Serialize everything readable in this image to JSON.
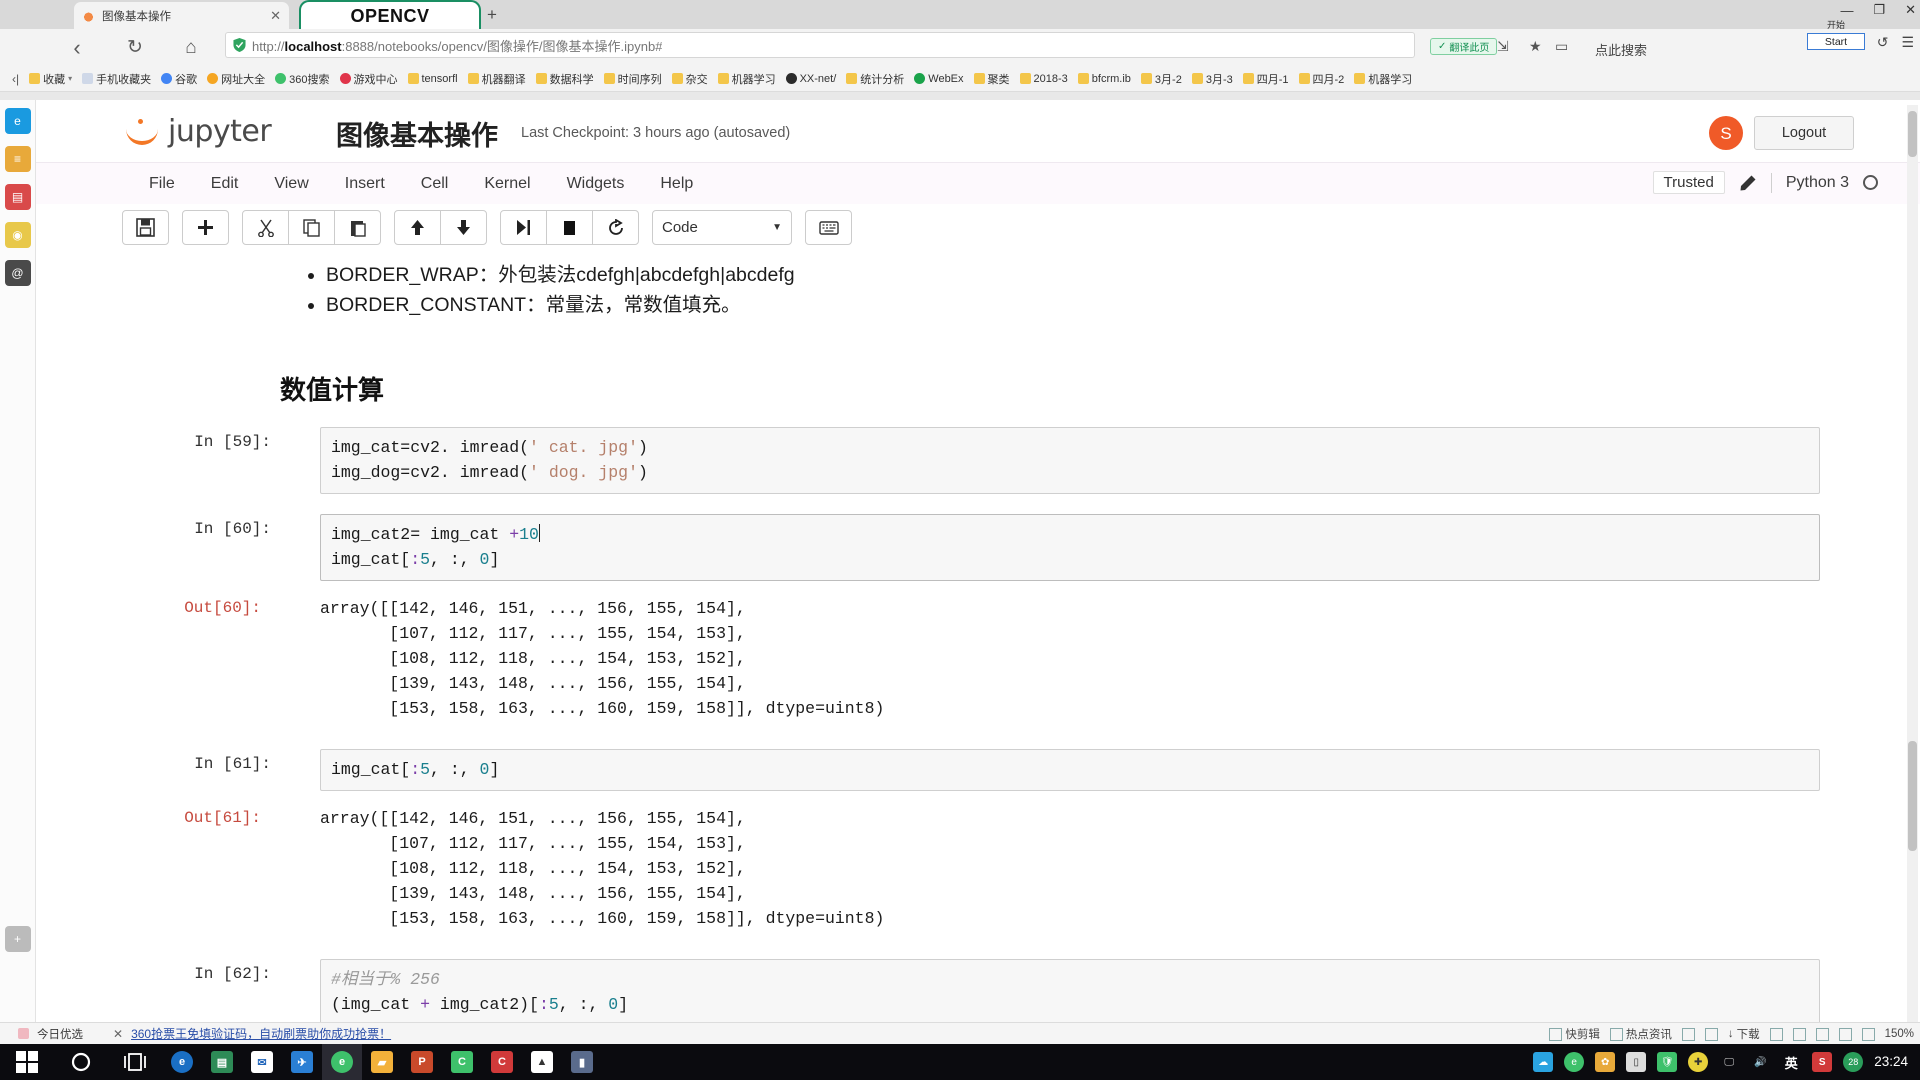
{
  "browser": {
    "tab": {
      "title": "图像基本操作",
      "close": "✕",
      "favicon_icon": "jupyter-favicon"
    },
    "tab_overlay": {
      "title": "OPENCV"
    },
    "new_tab": "+",
    "window_controls": {
      "minimize": "—",
      "maximize": "❐",
      "close": "✕"
    },
    "nav": {
      "back": "‹",
      "reload": "↻",
      "home": "⌂"
    },
    "url": {
      "scheme": "http://",
      "host": "localhost",
      "rest": ":8888/notebooks/opencv/图像操作/图像基本操作.ipynb#"
    },
    "translate_chip": "翻译此页",
    "search_hint": "点此搜索",
    "right_icons": {
      "share": "share-icon",
      "star": "star-icon",
      "collections": "collections-icon",
      "history": "history-icon",
      "menu": "menu-icon"
    },
    "bookmarks": [
      {
        "label": "收藏",
        "color": "#f3c64a"
      },
      {
        "label": "手机收藏夹",
        "color": "#cfd8e8"
      },
      {
        "label": "谷歌",
        "color": "#4285f4"
      },
      {
        "label": "网址大全",
        "color": "#f5a623"
      },
      {
        "label": "360搜索",
        "color": "#3ec16b"
      },
      {
        "label": "游戏中心",
        "color": "#e0344a"
      },
      {
        "label": "tensorfl",
        "color": "#f3c64a"
      },
      {
        "label": "机器翻译",
        "color": "#f3c64a"
      },
      {
        "label": "数据科学",
        "color": "#f3c64a"
      },
      {
        "label": "时间序列",
        "color": "#f3c64a"
      },
      {
        "label": "杂交",
        "color": "#f3c64a"
      },
      {
        "label": "机器学习",
        "color": "#f3c64a"
      },
      {
        "label": "XX-net/",
        "color": "#2b2b2b"
      },
      {
        "label": "统计分析",
        "color": "#f3c64a"
      },
      {
        "label": "WebEx",
        "color": "#1aa34a"
      },
      {
        "label": "聚类",
        "color": "#f3c64a"
      },
      {
        "label": "2018-3",
        "color": "#f3c64a"
      },
      {
        "label": "bfcrm.ib",
        "color": "#f3c64a"
      },
      {
        "label": "3月-2",
        "color": "#f3c64a"
      },
      {
        "label": "3月-3",
        "color": "#f3c64a"
      },
      {
        "label": "四月-1",
        "color": "#f3c64a"
      },
      {
        "label": "四月-2",
        "color": "#f3c64a"
      },
      {
        "label": "机器学习",
        "color": "#f3c64a"
      }
    ]
  },
  "start_popup": {
    "caption": "开始",
    "button": "Start"
  },
  "left_strip": [
    {
      "name": "edge-icon",
      "color": "#1a9ae0",
      "glyph": "e"
    },
    {
      "name": "note-icon",
      "color": "#e8a93a",
      "glyph": "≡"
    },
    {
      "name": "docs-icon",
      "color": "#d94a4a",
      "glyph": "▤"
    },
    {
      "name": "eye-icon",
      "color": "#e8c84a",
      "glyph": "◉"
    },
    {
      "name": "at-icon",
      "color": "#4a4a4a",
      "glyph": "@"
    },
    {
      "name": "add-icon",
      "color": "#888888",
      "glyph": "+"
    }
  ],
  "jupyter": {
    "brand": "jupyter",
    "notebook_title": "图像基本操作",
    "checkpoint": "Last Checkpoint: 3 hours ago (autosaved)",
    "logout": "Logout",
    "menu": [
      "File",
      "Edit",
      "View",
      "Insert",
      "Cell",
      "Kernel",
      "Widgets",
      "Help"
    ],
    "trusted": "Trusted",
    "edit_mode_icon": "pencil-icon",
    "kernel_name": "Python 3",
    "kernel_status": "idle-circle-icon",
    "toolbar": {
      "groups": [
        [
          {
            "name": "save-button",
            "glyph": "💾"
          }
        ],
        [
          {
            "name": "insert-cell-below-button",
            "glyph": "✚"
          }
        ],
        [
          {
            "name": "cut-cell-button",
            "glyph": "✂"
          },
          {
            "name": "copy-cell-button",
            "glyph": "⧉"
          },
          {
            "name": "paste-cell-button",
            "glyph": "📋"
          }
        ],
        [
          {
            "name": "move-cell-up-button",
            "glyph": "↑"
          },
          {
            "name": "move-cell-down-button",
            "glyph": "↓"
          }
        ],
        [
          {
            "name": "run-cell-button",
            "glyph": "▶|"
          },
          {
            "name": "interrupt-kernel-button",
            "glyph": "■"
          },
          {
            "name": "restart-kernel-button",
            "glyph": "⟳"
          }
        ]
      ],
      "cell_type": "Code",
      "cell_type_arrow": "▼",
      "command_palette": {
        "name": "command-palette-button",
        "glyph": "⌨"
      }
    }
  },
  "notebook": {
    "markdown_bullets": [
      "BORDER_WRAP：外包装法cdefgh|abcdefgh|abcdefg",
      "BORDER_CONSTANT：常量法，常数值填充。"
    ],
    "heading": "数值计算",
    "cells": [
      {
        "prompt": "In [59]:",
        "lines": [
          [
            {
              "t": "img_cat=cv2. imread("
            },
            {
              "t": "' cat. jpg'",
              "c": "str"
            },
            {
              "t": ")"
            }
          ],
          [
            {
              "t": "img_dog=cv2. imread("
            },
            {
              "t": "' dog. jpg'",
              "c": "str"
            },
            {
              "t": ")"
            }
          ]
        ]
      },
      {
        "prompt": "In [60]:",
        "selected": true,
        "lines": [
          [
            {
              "t": "img_cat2= img_cat "
            },
            {
              "t": "+",
              "c": "op"
            },
            {
              "t": "10",
              "c": "num"
            },
            {
              "t": "",
              "caret": true
            }
          ],
          [
            {
              "t": "img_cat["
            },
            {
              "t": ":",
              "c": "op"
            },
            {
              "t": "5",
              "c": "num"
            },
            {
              "t": ", :, "
            },
            {
              "t": "0",
              "c": "num"
            },
            {
              "t": "]"
            }
          ]
        ],
        "output_prompt": "Out[60]:",
        "output": "array([[142, 146, 151, ..., 156, 155, 154],\n       [107, 112, 117, ..., 155, 154, 153],\n       [108, 112, 118, ..., 154, 153, 152],\n       [139, 143, 148, ..., 156, 155, 154],\n       [153, 158, 163, ..., 160, 159, 158]], dtype=uint8)"
      },
      {
        "prompt": "In [61]:",
        "lines": [
          [
            {
              "t": "img_cat["
            },
            {
              "t": ":",
              "c": "op"
            },
            {
              "t": "5",
              "c": "num"
            },
            {
              "t": ", :, "
            },
            {
              "t": "0",
              "c": "num"
            },
            {
              "t": "]"
            }
          ]
        ],
        "output_prompt": "Out[61]:",
        "output": "array([[142, 146, 151, ..., 156, 155, 154],\n       [107, 112, 117, ..., 155, 154, 153],\n       [108, 112, 118, ..., 154, 153, 152],\n       [139, 143, 148, ..., 156, 155, 154],\n       [153, 158, 163, ..., 160, 159, 158]], dtype=uint8)"
      },
      {
        "prompt": "In [62]:",
        "lines": [
          [
            {
              "t": "#相当于% 256",
              "c": "cmt"
            }
          ],
          [
            {
              "t": "(img_cat "
            },
            {
              "t": "+",
              "c": "op"
            },
            {
              "t": " img_cat2)["
            },
            {
              "t": ":",
              "c": "op"
            },
            {
              "t": "5",
              "c": "num"
            },
            {
              "t": ", :, "
            },
            {
              "t": "0",
              "c": "num"
            },
            {
              "t": "]"
            }
          ]
        ]
      }
    ]
  },
  "notification": {
    "brand": "今日优选",
    "close": "✕",
    "text": "360抢票王免填验证码，自动刷票助你成功抢票！"
  },
  "status_right": [
    {
      "label": "快剪辑",
      "icon": "scissors-icon",
      "color": "#3aa36a"
    },
    {
      "label": "热点资讯",
      "icon": "news-icon",
      "color": "#3a7bd5"
    },
    {
      "label": "",
      "icon": "image-icon",
      "color": "#777777"
    },
    {
      "label": "",
      "icon": "cursor-icon",
      "color": "#777777"
    },
    {
      "label": "下载",
      "icon": "download-icon",
      "color": "#555555"
    },
    {
      "label": "",
      "icon": "flag-icon",
      "color": "#777777"
    },
    {
      "label": "",
      "icon": "mute-icon",
      "color": "#777777"
    },
    {
      "label": "",
      "icon": "window-icon",
      "color": "#777777"
    },
    {
      "label": "",
      "icon": "chart-icon",
      "color": "#777777"
    },
    {
      "label": "",
      "icon": "zoom-icon",
      "color": "#777777"
    },
    {
      "label": "150%",
      "icon": "zoom-level",
      "color": "#555555"
    }
  ],
  "taskbar": {
    "start": "start-icon",
    "cortana": "cortana-icon",
    "taskview": "task-view-icon",
    "apps": [
      {
        "name": "internet-explorer",
        "color": "#1a6fc4",
        "glyph": "e"
      },
      {
        "name": "store",
        "color": "#2e8b57",
        "glyph": "▤"
      },
      {
        "name": "mail",
        "color": "#ffffff",
        "glyph": "✉"
      },
      {
        "name": "foxmail",
        "color": "#2a7fd4",
        "glyph": "✈"
      },
      {
        "name": "browser-360",
        "color": "#3ec16b",
        "glyph": "e"
      },
      {
        "name": "file-explorer",
        "color": "#f3b13a",
        "glyph": "▰"
      },
      {
        "name": "powerpoint",
        "color": "#c94a2b",
        "glyph": "P"
      },
      {
        "name": "wechat",
        "color": "#3ec16b",
        "glyph": "C"
      },
      {
        "name": "cdr",
        "color": "#d13a3a",
        "glyph": "C"
      },
      {
        "name": "photos",
        "color": "#ffffff",
        "glyph": "▲"
      },
      {
        "name": "editor",
        "color": "#5a6b8c",
        "glyph": "▮"
      }
    ],
    "tray": [
      {
        "name": "onedrive-icon",
        "color": "#2aa3e0",
        "glyph": "☁"
      },
      {
        "name": "browser-tray-icon",
        "color": "#3ec16b",
        "glyph": "e"
      },
      {
        "name": "pinned-icon",
        "color": "#e8a93a",
        "glyph": "✿"
      },
      {
        "name": "usb-icon",
        "color": "#dddddd",
        "glyph": "▯"
      },
      {
        "name": "shield-icon",
        "color": "#3ec16b",
        "glyph": "🛡"
      },
      {
        "name": "security-icon",
        "color": "#e8d13a",
        "glyph": "✚"
      },
      {
        "name": "network-icon",
        "color": "#cccccc",
        "glyph": "🖵"
      },
      {
        "name": "volume-icon",
        "color": "#dddddd",
        "glyph": "🔊"
      },
      {
        "name": "ime-icon",
        "color": "#ffffff",
        "glyph": "英"
      },
      {
        "name": "sogou-icon",
        "color": "#d13a3a",
        "glyph": "S"
      },
      {
        "name": "badge-icon",
        "color": "#2a9d5a",
        "glyph": "28"
      }
    ],
    "clock": "23:24"
  }
}
